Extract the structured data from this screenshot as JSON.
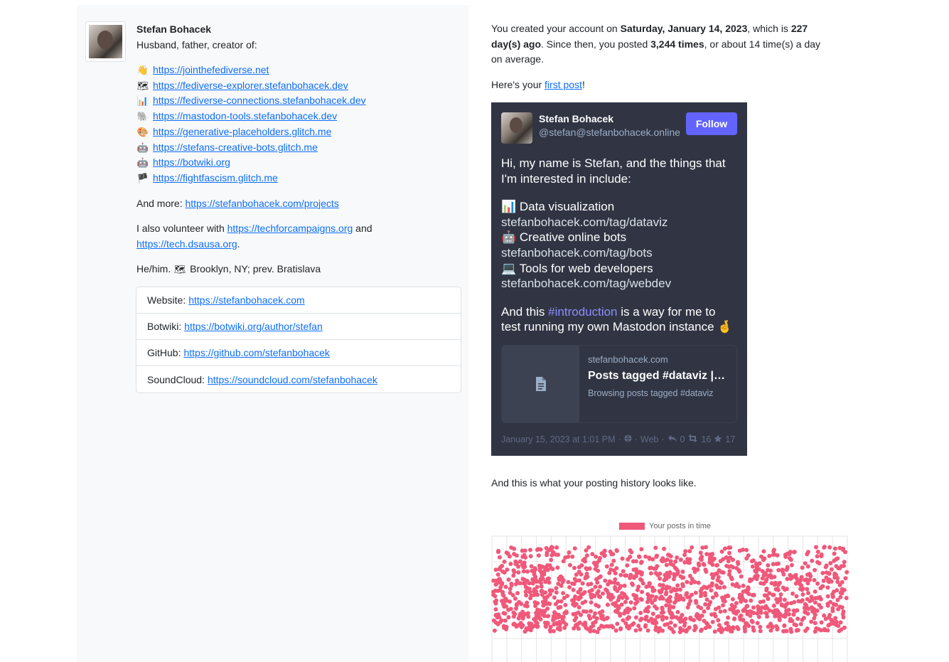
{
  "profile": {
    "name": "Stefan Bohacek",
    "tagline": "Husband, father, creator of:",
    "links": [
      {
        "icon": "waving-hand-icon",
        "emoji": "👋",
        "url": "https://jointhefediverse.net"
      },
      {
        "icon": "map-icon",
        "emoji": "🗺",
        "url": "https://fediverse-explorer.stefanbohacek.dev"
      },
      {
        "icon": "bar-chart-icon",
        "emoji": "📊",
        "url": "https://fediverse-connections.stefanbohacek.dev"
      },
      {
        "icon": "elephant-icon",
        "emoji": "🐘",
        "url": "https://mastodon-tools.stefanbohacek.dev"
      },
      {
        "icon": "palette-icon",
        "emoji": "🎨",
        "url": "https://generative-placeholders.glitch.me"
      },
      {
        "icon": "robot-icon",
        "emoji": "🤖",
        "url": "https://stefans-creative-bots.glitch.me"
      },
      {
        "icon": "robot-icon",
        "emoji": "🤖",
        "url": "https://botwiki.org"
      },
      {
        "icon": "black-flag-icon",
        "emoji": "🏴",
        "url": "https://fightfascism.glitch.me"
      }
    ],
    "more_label": "And more:",
    "more_url": "https://stefanbohacek.com/projects",
    "volunteer_prefix": "I also volunteer with",
    "volunteer_url1": "https://techforcampaigns.org",
    "volunteer_and": "and",
    "volunteer_url2": "https://tech.dsausa.org",
    "volunteer_end": ".",
    "pronouns_prefix": "He/him.",
    "location_icon": "map-icon",
    "location_emoji": "🗺",
    "location": "Brooklyn, NY; prev. Bratislava",
    "fields": [
      {
        "label": "Website:",
        "value": "https://stefanbohacek.com"
      },
      {
        "label": "Botwiki:",
        "value": "https://botwiki.org/author/stefan"
      },
      {
        "label": "GitHub:",
        "value": "https://github.com/stefanbohacek"
      },
      {
        "label": "SoundCloud:",
        "value": "https://soundcloud.com/stefanbohacek"
      }
    ]
  },
  "stats": {
    "created_prefix": "You created your account on",
    "created_date": "Saturday, January 14, 2023",
    "which_is": ", which is",
    "days_ago": "227 day(s) ago",
    "since_then": ". Since then, you posted",
    "post_count": "3,244 times",
    "average": ", or about 14 time(s) a day on average.",
    "first_post_prefix": "Here's your",
    "first_post_link": "first post",
    "first_post_end": "!",
    "history_text": "And this is what your posting history looks like."
  },
  "embed": {
    "name": "Stefan Bohacek",
    "handle": "@stefan@stefanbohacek.online",
    "follow_label": "Follow",
    "line1": "Hi, my name is Stefan, and the things that I'm interested in include:",
    "item1_emoji": "📊",
    "item1": "Data visualization",
    "item1_link": "stefanbohacek.com/tag/dataviz",
    "item2_emoji": "🤖",
    "item2": "Creative online bots",
    "item2_link": "stefanbohacek.com/tag/bots",
    "item3_emoji": "💻",
    "item3": "Tools for web developers",
    "item3_link": "stefanbohacek.com/tag/webdev",
    "closing_prefix": "And this",
    "hashtag": "#introduction",
    "closing_suffix": "is a way for me to test running my own Mastodon instance",
    "closing_emoji": "🤞",
    "card_domain": "stefanbohacek.com",
    "card_title": "Posts tagged #dataviz |…",
    "card_desc": "Browsing posts tagged #dataviz",
    "card_icon": "document-icon",
    "meta_date": "January 15, 2023 at 1:01 PM",
    "meta_visibility_icon": "globe-icon",
    "meta_app": "Web",
    "replies": "0",
    "boosts": "16",
    "favourites": "17"
  },
  "chart_data": {
    "type": "scatter",
    "series": [
      {
        "name": "Your posts in time",
        "color": "#f0587a"
      }
    ],
    "xlabel": "",
    "ylabel": "",
    "grid": true,
    "legend": "top-center"
  }
}
